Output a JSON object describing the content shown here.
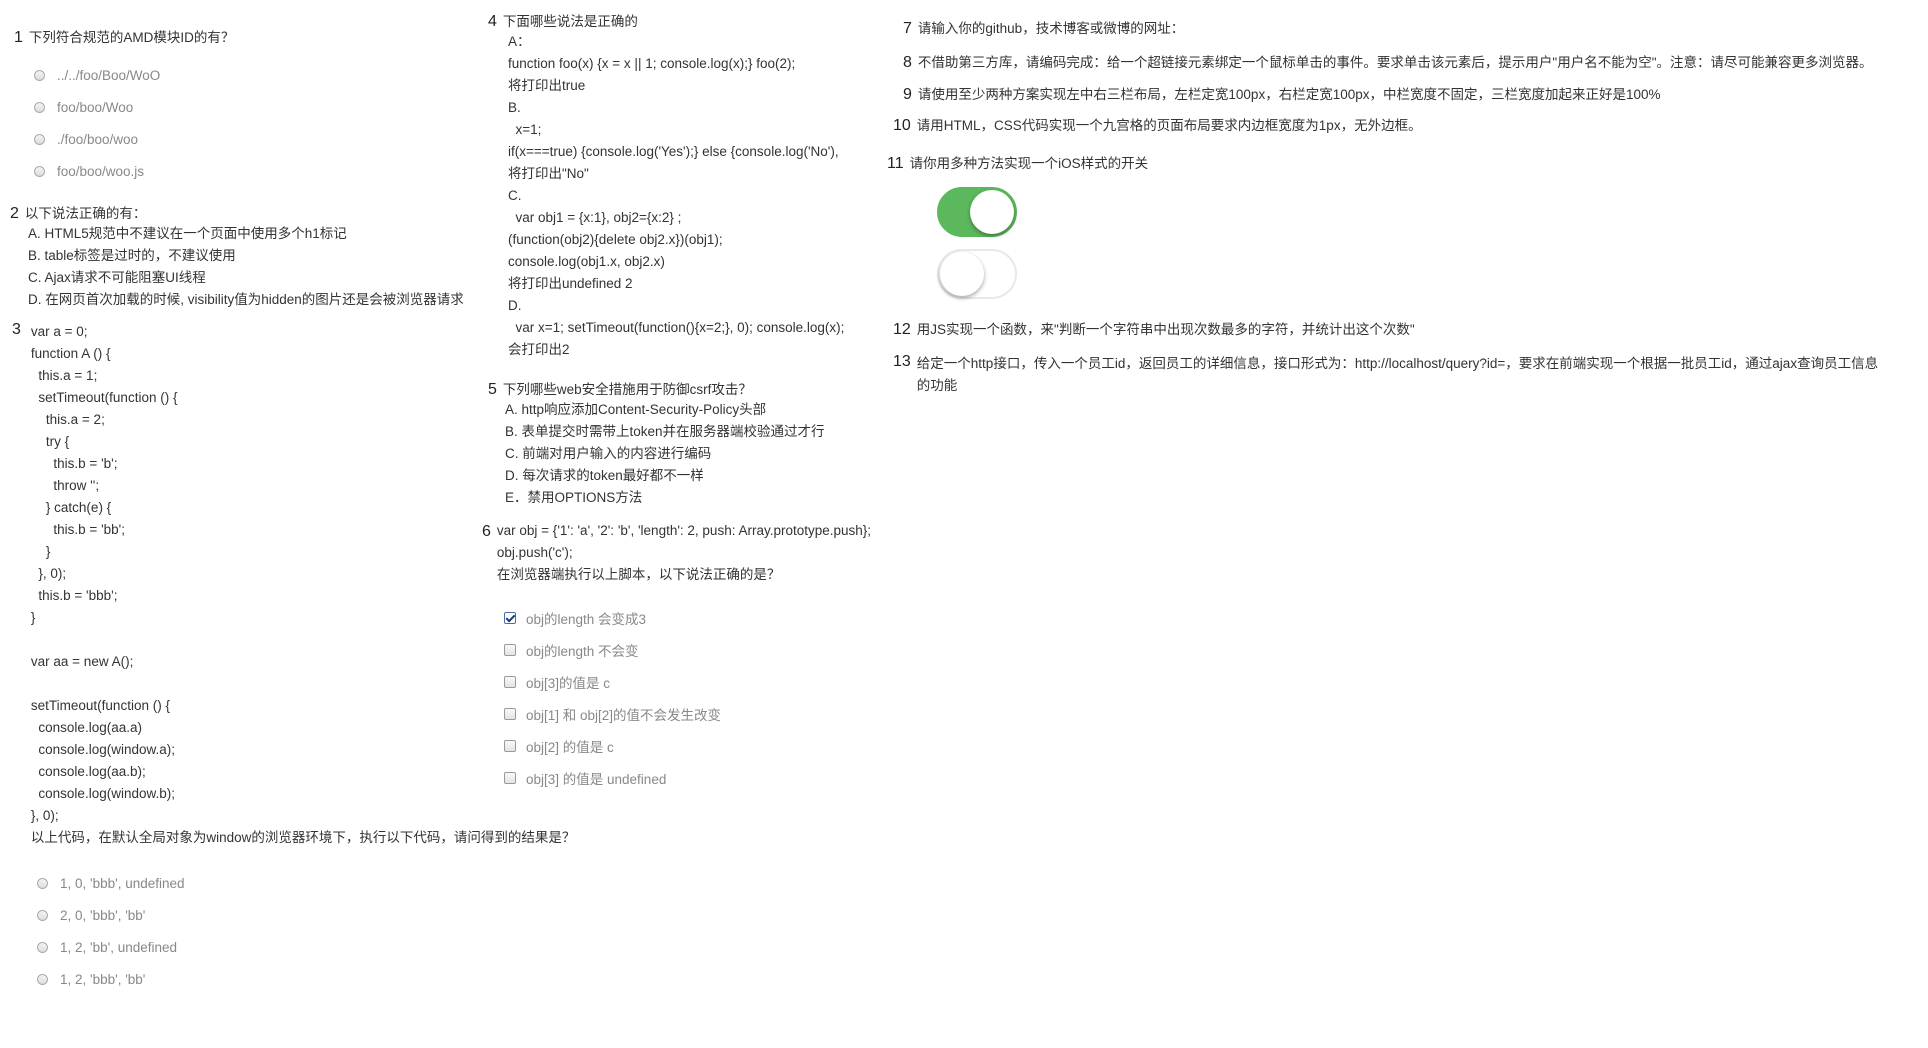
{
  "accent_green": "#5cb85c",
  "q1": {
    "num": "1",
    "title": "下列符合规范的AMD模块ID的有？",
    "options": [
      "../../foo/Boo/WoO",
      "foo/boo/Woo",
      "./foo/boo/woo",
      "foo/boo/woo.js"
    ]
  },
  "q2": {
    "num": "2",
    "title": "以下说法正确的有：",
    "lines": [
      "A. HTML5规范中不建议在一个页面中使用多个h1标记",
      "B. table标签是过时的，不建议使用",
      "C. Ajax请求不可能阻塞UI线程",
      "D. 在网页首次加载的时候, visibility值为hidden的图片还是会被浏览器请求"
    ]
  },
  "q3": {
    "num": "3",
    "code": [
      "var a = 0;",
      "function A () {",
      "  this.a = 1;",
      "  setTimeout(function () {",
      "    this.a = 2;",
      "    try {",
      "      this.b = 'b';",
      "      throw '';",
      "    } catch(e) {",
      "      this.b = 'bb';",
      "    }",
      "  }, 0);",
      "  this.b = 'bbb';",
      "}",
      "",
      "var aa = new A();",
      "",
      "setTimeout(function () {",
      "  console.log(aa.a)",
      "  console.log(window.a);",
      "  console.log(aa.b);",
      "  console.log(window.b);",
      "}, 0);"
    ],
    "question": "以上代码，在默认全局对象为window的浏览器环境下，执行以下代码，请问得到的结果是？",
    "options": [
      "1, 0, 'bbb', undefined",
      "2, 0, 'bbb', 'bb'",
      "1, 2, 'bb', undefined",
      "1, 2, 'bbb', 'bb'"
    ]
  },
  "q4": {
    "num": "4",
    "title": "下面哪些说法是正确的",
    "lines": [
      "A：",
      "function foo(x) {x = x || 1; console.log(x);} foo(2);",
      "将打印出true",
      "B.",
      "  x=1;",
      "if(x===true) {console.log('Yes');} else {console.log('No'),",
      "将打印出\"No\"",
      "C.",
      "  var obj1 = {x:1}, obj2={x:2} ;",
      "(function(obj2){delete obj2.x})(obj1);",
      "console.log(obj1.x, obj2.x)",
      "将打印出undefined 2",
      "D.",
      "  var x=1; setTimeout(function(){x=2;}, 0); console.log(x);",
      "会打印出2"
    ]
  },
  "q5": {
    "num": "5",
    "title": "下列哪些web安全措施用于防御csrf攻击？",
    "lines": [
      "A. http响应添加Content-Security-Policy头部",
      "B. 表单提交时需带上token并在服务器端校验通过才行",
      "C. 前端对用户输入的内容进行编码",
      "D. 每次请求的token最好都不一样",
      "E．禁用OPTIONS方法"
    ]
  },
  "q6": {
    "num": "6",
    "lines": [
      "var obj = {'1': 'a', '2': 'b', 'length': 2, push: Array.prototype.push};",
      "obj.push('c');",
      "在浏览器端执行以上脚本，以下说法正确的是？"
    ],
    "options": [
      {
        "label": "obj的length 会变成3",
        "checked": true
      },
      {
        "label": "obj的length 不会变",
        "checked": false
      },
      {
        "label": "obj[3]的值是 c",
        "checked": false
      },
      {
        "label": "obj[1] 和 obj[2]的值不会发生改变",
        "checked": false
      },
      {
        "label": "obj[2] 的值是 c",
        "checked": false
      },
      {
        "label": "obj[3] 的值是 undefined",
        "checked": false
      }
    ]
  },
  "q7": {
    "num": "7",
    "title": "请输入你的github，技术博客或微博的网址："
  },
  "q8": {
    "num": "8",
    "title": "不借助第三方库，请编码完成：给一个超链接元素绑定一个鼠标单击的事件。要求单击该元素后，提示用户\"用户名不能为空\"。注意：请尽可能兼容更多浏览器。"
  },
  "q9": {
    "num": "9",
    "title": "请使用至少两种方案实现左中右三栏布局，左栏定宽100px，右栏定宽100px，中栏宽度不固定，三栏宽度加起来正好是100%"
  },
  "q10": {
    "num": "10",
    "title": "请用HTML，CSS代码实现一个九宫格的页面布局要求内边框宽度为1px，无外边框。"
  },
  "q11": {
    "num": "11",
    "title": "请你用多种方法实现一个iOS样式的开关",
    "switches": [
      {
        "on": true
      },
      {
        "on": false
      }
    ]
  },
  "q12": {
    "num": "12",
    "title": "用JS实现一个函数，来\"判断一个字符串中出现次数最多的字符，并统计出这个次数\""
  },
  "q13": {
    "num": "13",
    "lines": [
      "给定一个http接口，传入一个员工id，返回员工的详细信息，接口形式为：http://localhost/query?id=，要求在前端实现一个根据一批员工id，通过ajax查询员工信息",
      "的功能"
    ]
  }
}
